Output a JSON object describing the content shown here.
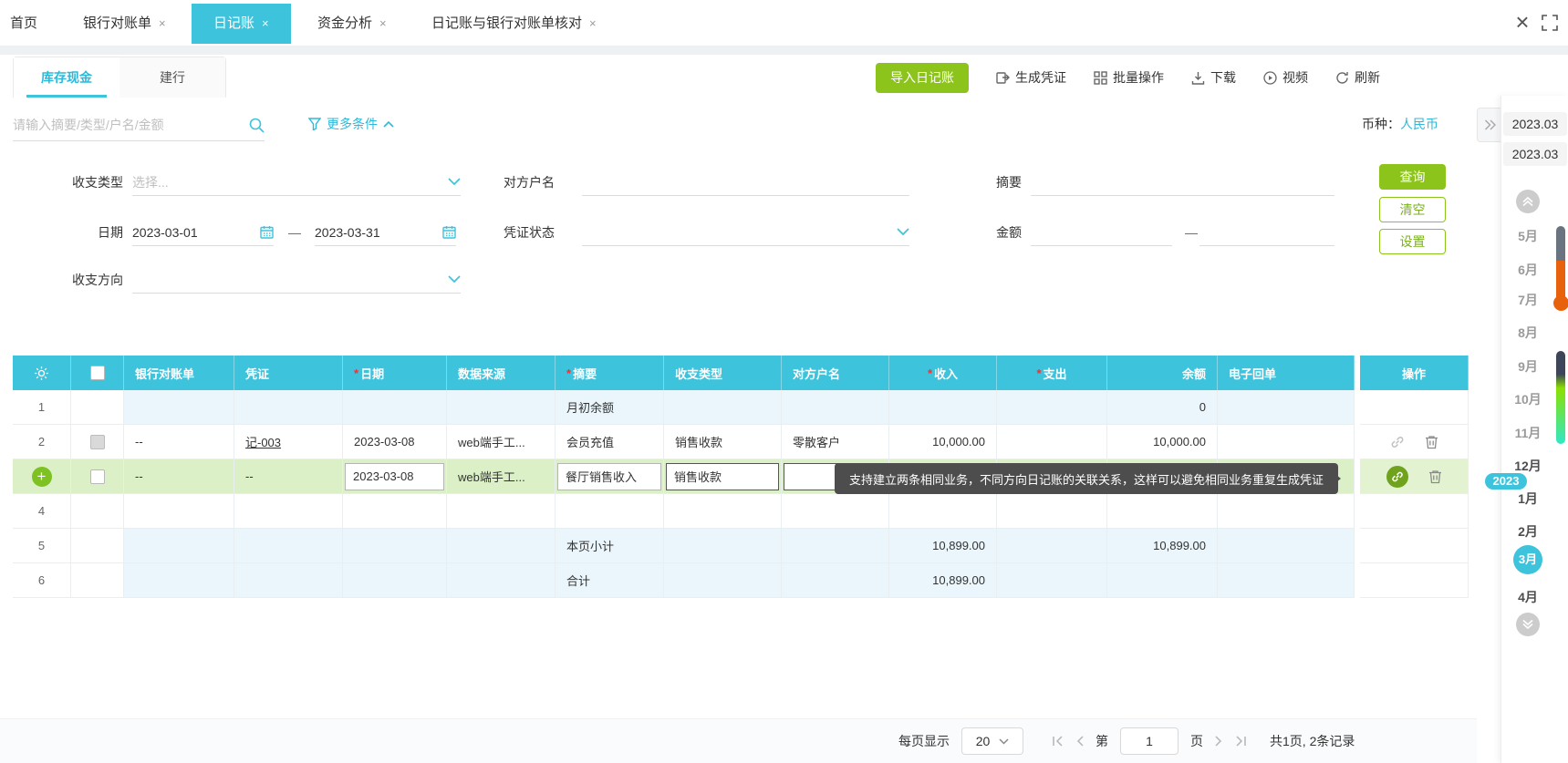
{
  "tabbar": {
    "home": "首页",
    "tabs": [
      {
        "label": "银行对账单"
      },
      {
        "label": "日记账"
      },
      {
        "label": "资金分析"
      },
      {
        "label": "日记账与银行对账单核对"
      }
    ],
    "close_glyph": "×"
  },
  "subtabs": {
    "cash": "库存现金",
    "bank": "建行"
  },
  "toolbar": {
    "import": "导入日记账",
    "gen_voucher": "生成凭证",
    "batch": "批量操作",
    "download": "下载",
    "video": "视频",
    "refresh": "刷新"
  },
  "search": {
    "placeholder": "请输入摘要/类型/户名/金额",
    "more": "更多条件"
  },
  "currency": {
    "label": "币种：",
    "value": "人民币"
  },
  "filters": {
    "type_label": "收支类型",
    "type_placeholder": "选择...",
    "party_label": "对方户名",
    "summary_label": "摘要",
    "date_label": "日期",
    "date_from": "2023-03-01",
    "date_to": "2023-03-31",
    "dash": "—",
    "voucher_status_label": "凭证状态",
    "amount_label": "金额",
    "direction_label": "收支方向",
    "query": "查询",
    "clear": "清空",
    "settings": "设置"
  },
  "table": {
    "req": "*",
    "headers": {
      "bank": "银行对账单",
      "voucher": "凭证",
      "date": "日期",
      "source": "数据来源",
      "summary": "摘要",
      "type": "收支类型",
      "party": "对方户名",
      "income": "收入",
      "expense": "支出",
      "balance": "余额",
      "receipt": "电子回单",
      "ops": "操作"
    },
    "rows": [
      {
        "num": "1",
        "summary": "月初余额",
        "balance": "0"
      },
      {
        "num": "2",
        "bank": "--",
        "voucher": "记-003",
        "date": "2023-03-08",
        "source": "web端手工...",
        "summary": "会员充值",
        "type": "销售收款",
        "party": "零散客户",
        "income": "10,000.00",
        "balance": "10,000.00"
      },
      {
        "bank": "--",
        "voucher": "--",
        "date": "2023-03-08",
        "source": "web端手工...",
        "summary": "餐厅销售收入",
        "type": "销售收款"
      },
      {
        "num": "4"
      },
      {
        "num": "5",
        "summary": "本页小计",
        "income": "10,899.00",
        "balance": "10,899.00"
      },
      {
        "num": "6",
        "summary": "合计",
        "income": "10,899.00"
      }
    ]
  },
  "tooltip": "支持建立两条相同业务，不同方向日记账的关联关系，这样可以避免相同业务重复生成凭证",
  "pagination": {
    "per_page_label": "每页显示",
    "per_page": "20",
    "page_prefix": "第",
    "page": "1",
    "page_suffix": "页",
    "total": "共1页, 2条记录"
  },
  "rail": {
    "period1": "2023.03",
    "period2": "2023.03",
    "year_badge": "2023",
    "months": [
      "5月",
      "6月",
      "7月",
      "8月",
      "9月",
      "10月",
      "11月",
      "12月",
      "1月",
      "2月",
      "3月",
      "4月"
    ]
  }
}
